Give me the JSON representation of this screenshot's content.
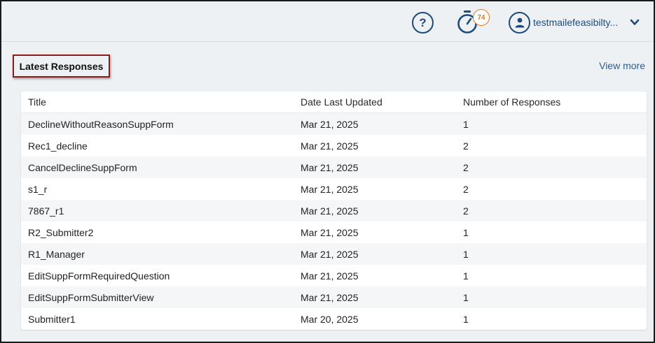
{
  "header": {
    "help_label": "?",
    "timer_count": "74",
    "username": "testmailefeasibilty...",
    "icons": {
      "help": "help-circle-icon",
      "timer": "stopwatch-icon",
      "user": "user-avatar-icon",
      "menu": "chevron-down-icon"
    },
    "colors": {
      "primary": "#1f4b7a",
      "badge": "#e07a1f"
    }
  },
  "section": {
    "title": "Latest Responses",
    "view_more": "View more"
  },
  "table": {
    "columns": [
      "Title",
      "Date Last Updated",
      "Number of Responses"
    ],
    "rows": [
      [
        "DeclineWithoutReasonSuppForm",
        "Mar 21, 2025",
        "1"
      ],
      [
        "Rec1_decline",
        "Mar 21, 2025",
        "2"
      ],
      [
        "CancelDeclineSuppForm",
        "Mar 21, 2025",
        "2"
      ],
      [
        "s1_r",
        "Mar 21, 2025",
        "2"
      ],
      [
        "7867_r1",
        "Mar 21, 2025",
        "2"
      ],
      [
        "R2_Submitter2",
        "Mar 21, 2025",
        "1"
      ],
      [
        "R1_Manager",
        "Mar 21, 2025",
        "1"
      ],
      [
        "EditSuppFormRequiredQuestion",
        "Mar 21, 2025",
        "1"
      ],
      [
        "EditSuppFormSubmitterView",
        "Mar 21, 2025",
        "1"
      ],
      [
        "Submitter1",
        "Mar 20, 2025",
        "1"
      ]
    ]
  }
}
